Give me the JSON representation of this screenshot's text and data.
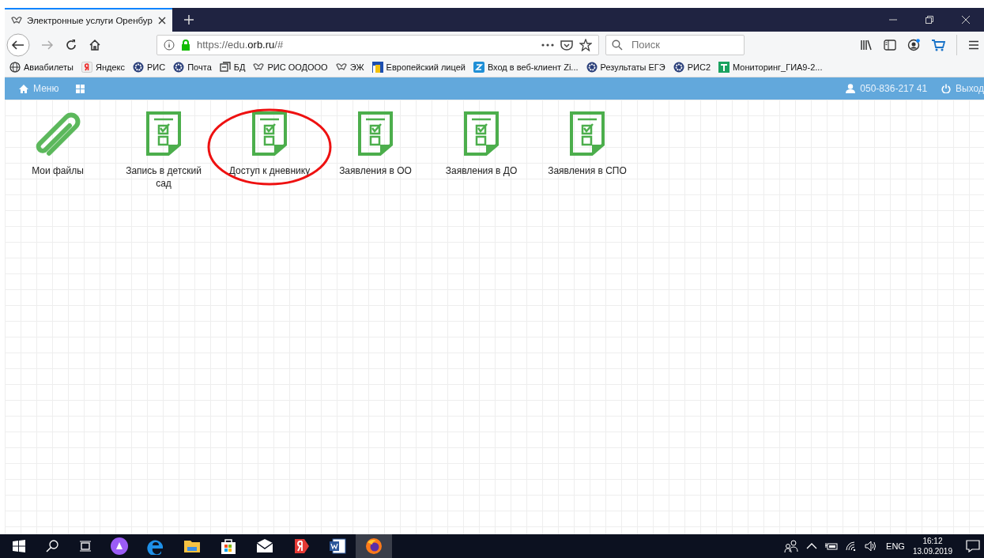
{
  "browser": {
    "tab": {
      "title": "Электронные услуги Оренбур",
      "selected": true
    },
    "address": {
      "scheme": "https://edu.",
      "domain": "orb.ru",
      "path": "/#"
    },
    "search": {
      "placeholder": "Поиск"
    },
    "bookmarks": [
      {
        "label": "Авиабилеты",
        "kind": "globe"
      },
      {
        "label": "Яндекс",
        "kind": "yandex"
      },
      {
        "label": "РИС",
        "kind": "gear"
      },
      {
        "label": "Почта",
        "kind": "gear"
      },
      {
        "label": "БД",
        "kind": "db"
      },
      {
        "label": "РИС ООДООО",
        "kind": "bird"
      },
      {
        "label": "ЭЖ",
        "kind": "bird"
      },
      {
        "label": "Европейский лицей",
        "kind": "flag"
      },
      {
        "label": "Вход в веб-клиент Zi...",
        "kind": "z"
      },
      {
        "label": "Результаты ЕГЭ",
        "kind": "gear"
      },
      {
        "label": "РИС2",
        "kind": "gear"
      },
      {
        "label": "Мониторинг_ГИА9-2...",
        "kind": "sheet"
      }
    ]
  },
  "app_bar": {
    "menu": "Меню",
    "user": "050-836-217 41",
    "logout": "Выход"
  },
  "tiles": [
    {
      "label": "Мои файлы",
      "kind": "clip",
      "circled": false
    },
    {
      "label": "Запись в детский сад",
      "kind": "form",
      "circled": false
    },
    {
      "label": "Доступ к дневнику",
      "kind": "form",
      "circled": true
    },
    {
      "label": "Заявления в ОО",
      "kind": "form",
      "circled": false
    },
    {
      "label": "Заявления в ДО",
      "kind": "form",
      "circled": false
    },
    {
      "label": "Заявления в СПО",
      "kind": "form",
      "circled": false
    }
  ],
  "taskbar": {
    "apps": [
      {
        "kind": "alice",
        "selected": false
      },
      {
        "kind": "edge",
        "selected": false
      },
      {
        "kind": "folder",
        "selected": false
      },
      {
        "kind": "store",
        "selected": false
      },
      {
        "kind": "mail",
        "selected": false
      },
      {
        "kind": "yabrowser",
        "selected": false
      },
      {
        "kind": "word",
        "selected": false
      },
      {
        "kind": "firefox",
        "selected": true
      }
    ],
    "language": "ENG",
    "time": "16:12",
    "date": "13.09.2019"
  }
}
